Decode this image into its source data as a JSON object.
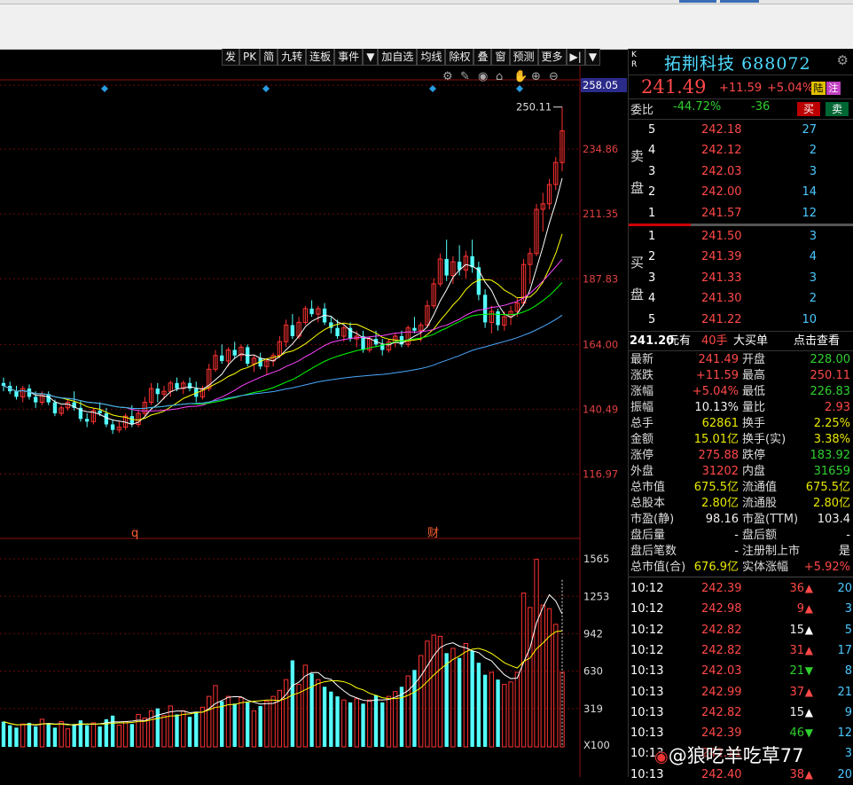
{
  "toolbar": {
    "items": [
      "发",
      "PK",
      "简",
      "九转",
      "连板",
      "事件",
      "▼",
      "加自选",
      "均线",
      "除权",
      "叠",
      "窗",
      "预测",
      "更多",
      "▶|",
      "▼"
    ]
  },
  "price_axis": [
    "258.05",
    "234.86",
    "211.35",
    "187.83",
    "164.00",
    "140.49",
    "116.97"
  ],
  "volume_axis": [
    "1565",
    "1253",
    "942",
    "630",
    "319",
    "X100"
  ],
  "chart_marks": {
    "high_label": "250.11",
    "event_q": "q",
    "event_cai": "财"
  },
  "chart_tools": [
    "settings-icon",
    "pen-icon",
    "eye-icon",
    "lock-icon",
    "hand-icon",
    "zoom-in-icon",
    "zoom-out-icon"
  ],
  "stock": {
    "kr": "K\nR",
    "name": "拓荆科技",
    "code": "688072",
    "price": "241.49",
    "change": "+11.59",
    "pct": "+5.04%",
    "badge": "陆",
    "badge2": "注",
    "weibi_label": "委比",
    "weibi": "-44.72%",
    "weicha": "-36",
    "buy_btn": "买",
    "sell_btn": "卖"
  },
  "asks_label": [
    "卖",
    "盘"
  ],
  "bids_label": [
    "买",
    "盘"
  ],
  "asks": [
    {
      "lv": "5",
      "price": "242.18",
      "vol": "27"
    },
    {
      "lv": "4",
      "price": "242.12",
      "vol": "2"
    },
    {
      "lv": "3",
      "price": "242.03",
      "vol": "3"
    },
    {
      "lv": "2",
      "price": "242.00",
      "vol": "14"
    },
    {
      "lv": "1",
      "price": "241.57",
      "vol": "12"
    }
  ],
  "bids": [
    {
      "lv": "1",
      "price": "241.50",
      "vol": "3"
    },
    {
      "lv": "2",
      "price": "241.39",
      "vol": "4"
    },
    {
      "lv": "3",
      "price": "241.33",
      "vol": "3"
    },
    {
      "lv": "4",
      "price": "241.30",
      "vol": "2"
    },
    {
      "lv": "5",
      "price": "241.22",
      "vol": "10"
    }
  ],
  "bigorder": {
    "price": "241.20",
    "suffix": "元有",
    "lots": "40手",
    "label": "大买单",
    "link": "点击查看"
  },
  "stats": [
    {
      "l1": "最新",
      "v1": "241.49",
      "c1": "red",
      "l2": "开盘",
      "v2": "228.00",
      "c2": "grn"
    },
    {
      "l1": "涨跌",
      "v1": "+11.59",
      "c1": "red",
      "l2": "最高",
      "v2": "250.11",
      "c2": "red"
    },
    {
      "l1": "涨幅",
      "v1": "+5.04%",
      "c1": "red",
      "l2": "最低",
      "v2": "226.83",
      "c2": "grn"
    },
    {
      "l1": "振幅",
      "v1": "10.13%",
      "c1": "wht",
      "l2": "量比",
      "v2": "2.93",
      "c2": "red"
    },
    {
      "l1": "总手",
      "v1": "62861",
      "c1": "yel",
      "l2": "换手",
      "v2": "2.25%",
      "c2": "yel"
    },
    {
      "l1": "金额",
      "v1": "15.01亿",
      "c1": "yel",
      "l2": "换手(实)",
      "v2": "3.38%",
      "c2": "yel"
    },
    {
      "l1": "涨停",
      "v1": "275.88",
      "c1": "red",
      "l2": "跌停",
      "v2": "183.92",
      "c2": "grn"
    },
    {
      "l1": "外盘",
      "v1": "31202",
      "c1": "red",
      "l2": "内盘",
      "v2": "31659",
      "c2": "grn"
    },
    {
      "l1": "总市值",
      "v1": "675.5亿",
      "c1": "yel",
      "l2": "流通值",
      "v2": "675.5亿",
      "c2": "yel"
    },
    {
      "l1": "总股本",
      "v1": "2.80亿",
      "c1": "yel",
      "l2": "流通股",
      "v2": "2.80亿",
      "c2": "yel"
    },
    {
      "l1": "市盈(静)",
      "v1": "98.16",
      "c1": "wht",
      "l2": "市盈(TTM)",
      "v2": "103.4",
      "c2": "wht"
    },
    {
      "l1": "盘后量",
      "v1": "-",
      "c1": "wht",
      "l2": "盘后额",
      "v2": "-",
      "c2": "wht"
    },
    {
      "l1": "盘后笔数",
      "v1": "-",
      "c1": "wht",
      "l2": "注册制上市",
      "v2": "是",
      "c2": "wht"
    },
    {
      "l1": "总市值(合)",
      "v1": "676.9亿",
      "c1": "yel",
      "l2": "实体涨幅",
      "v2": "+5.92%",
      "c2": "red"
    }
  ],
  "ticks": [
    {
      "t": "10:12",
      "p": "242.39",
      "v": "36",
      "dir": "up",
      "c": "red",
      "n": "20"
    },
    {
      "t": "10:12",
      "p": "242.98",
      "v": "9",
      "dir": "up",
      "c": "red",
      "n": "3"
    },
    {
      "t": "10:12",
      "p": "242.82",
      "v": "15",
      "dir": "up",
      "c": "wht",
      "n": "5"
    },
    {
      "t": "10:12",
      "p": "242.82",
      "v": "31",
      "dir": "up",
      "c": "red",
      "n": "17"
    },
    {
      "t": "10:13",
      "p": "242.03",
      "v": "21",
      "dir": "down",
      "c": "grn",
      "n": "8"
    },
    {
      "t": "10:13",
      "p": "242.99",
      "v": "37",
      "dir": "up",
      "c": "red",
      "n": "21"
    },
    {
      "t": "10:13",
      "p": "242.82",
      "v": "15",
      "dir": "up",
      "c": "wht",
      "n": "9"
    },
    {
      "t": "10:13",
      "p": "242.39",
      "v": "46",
      "dir": "down",
      "c": "grn",
      "n": "12"
    },
    {
      "t": "10:13",
      "p": "242.11",
      "v": "",
      "dir": "",
      "c": "wht",
      "n": "3"
    },
    {
      "t": "10:13",
      "p": "242.40",
      "v": "38",
      "dir": "up",
      "c": "red",
      "n": "20"
    }
  ],
  "watermark": "@狼吃羊吃草77",
  "colors": {
    "up": "#ff3232",
    "down": "#54ffff",
    "ma5": "#ffffff",
    "ma10": "#ffff00",
    "ma20": "#ff44ff",
    "ma30": "#00ff00",
    "ma60": "#4aa8ff"
  },
  "chart_data": {
    "type": "candlestick",
    "ylim": [
      116.97,
      258.05
    ],
    "ylim_volume_x100": [
      0,
      1565
    ],
    "ohlc": [
      [
        150.0,
        152.0,
        147.0,
        149.0
      ],
      [
        149.0,
        150.5,
        146.0,
        147.0
      ],
      [
        147.0,
        149.0,
        144.0,
        145.0
      ],
      [
        145.0,
        149.0,
        143.0,
        148.0
      ],
      [
        148.0,
        149.5,
        144.0,
        145.0
      ],
      [
        145.0,
        147.0,
        141.0,
        143.0
      ],
      [
        143.0,
        147.0,
        142.0,
        146.0
      ],
      [
        146.0,
        147.0,
        142.0,
        143.0
      ],
      [
        143.0,
        144.0,
        138.0,
        139.0
      ],
      [
        139.0,
        142.0,
        138.0,
        141.0
      ],
      [
        141.0,
        144.0,
        140.0,
        143.0
      ],
      [
        143.0,
        147.0,
        140.0,
        141.0
      ],
      [
        141.0,
        143.5,
        136.0,
        137.0
      ],
      [
        137.0,
        139.0,
        134.0,
        136.0
      ],
      [
        136.0,
        141.0,
        135.0,
        140.0
      ],
      [
        140.0,
        143.0,
        138.0,
        139.0
      ],
      [
        139.0,
        141.0,
        134.0,
        135.0
      ],
      [
        135.0,
        136.5,
        131.5,
        133.0
      ],
      [
        133.0,
        136.0,
        132.0,
        134.0
      ],
      [
        134.0,
        139.0,
        133.0,
        138.0
      ],
      [
        138.0,
        142.0,
        134.0,
        135.0
      ],
      [
        135.0,
        140.0,
        134.0,
        139.0
      ],
      [
        139.0,
        145.0,
        138.0,
        143.0
      ],
      [
        143.0,
        150.0,
        142.0,
        148.0
      ],
      [
        148.0,
        150.0,
        143.0,
        146.0
      ],
      [
        146.0,
        149.0,
        144.0,
        147.0
      ],
      [
        147.0,
        151.0,
        145.0,
        150.0
      ],
      [
        150.0,
        152.0,
        147.0,
        148.0
      ],
      [
        148.0,
        151.0,
        146.0,
        150.0
      ],
      [
        150.0,
        152.0,
        147.0,
        148.0
      ],
      [
        148.0,
        150.5,
        143.0,
        145.0
      ],
      [
        145.0,
        149.0,
        144.0,
        148.0
      ],
      [
        148.0,
        157.0,
        147.0,
        155.0
      ],
      [
        155.0,
        162.0,
        154.0,
        160.0
      ],
      [
        160.0,
        164.0,
        157.0,
        158.0
      ],
      [
        158.0,
        163.0,
        156.0,
        162.0
      ],
      [
        162.0,
        165.0,
        159.0,
        160.0
      ],
      [
        160.0,
        164.0,
        158.0,
        163.0
      ],
      [
        163.0,
        164.0,
        156.0,
        157.0
      ],
      [
        157.0,
        160.0,
        154.0,
        159.0
      ],
      [
        159.0,
        161.0,
        155.0,
        156.0
      ],
      [
        156.0,
        159.0,
        153.0,
        158.0
      ],
      [
        158.0,
        161.0,
        156.0,
        160.0
      ],
      [
        160.0,
        167.0,
        159.0,
        165.0
      ],
      [
        165.0,
        173.0,
        163.0,
        171.0
      ],
      [
        171.0,
        175.0,
        166.0,
        167.0
      ],
      [
        167.0,
        174.0,
        166.0,
        172.0
      ],
      [
        172.0,
        178.0,
        171.0,
        177.0
      ],
      [
        177.0,
        180.0,
        174.0,
        175.0
      ],
      [
        175.0,
        178.0,
        172.0,
        177.0
      ],
      [
        177.0,
        179.0,
        171.0,
        172.0
      ],
      [
        172.0,
        174.0,
        168.0,
        170.0
      ],
      [
        170.0,
        173.0,
        166.0,
        167.0
      ],
      [
        167.0,
        171.0,
        165.0,
        170.0
      ],
      [
        170.0,
        172.0,
        165.0,
        166.0
      ],
      [
        166.0,
        169.0,
        163.0,
        167.0
      ],
      [
        167.0,
        169.0,
        161.0,
        162.0
      ],
      [
        162.0,
        167.0,
        161.0,
        166.0
      ],
      [
        166.0,
        169.0,
        163.0,
        164.0
      ],
      [
        164.0,
        166.0,
        160.0,
        162.0
      ],
      [
        162.0,
        166.0,
        161.0,
        165.0
      ],
      [
        165.0,
        168.0,
        163.0,
        167.0
      ],
      [
        167.0,
        169.0,
        163.0,
        164.0
      ],
      [
        164.0,
        171.0,
        163.0,
        170.0
      ],
      [
        170.0,
        174.0,
        168.0,
        169.0
      ],
      [
        169.0,
        172.0,
        165.0,
        171.0
      ],
      [
        171.0,
        180.0,
        170.0,
        178.0
      ],
      [
        178.0,
        188.0,
        177.0,
        186.0
      ],
      [
        186.0,
        197.0,
        185.0,
        195.0
      ],
      [
        195.0,
        202.0,
        187.0,
        189.0
      ],
      [
        189.0,
        196.0,
        186.0,
        194.0
      ],
      [
        194.0,
        200.0,
        189.0,
        191.0
      ],
      [
        191.0,
        198.0,
        188.0,
        196.0
      ],
      [
        196.0,
        202.0,
        190.0,
        192.0
      ],
      [
        192.0,
        194.0,
        180.0,
        182.0
      ],
      [
        182.0,
        184.0,
        170.0,
        172.0
      ],
      [
        172.0,
        178.0,
        168.0,
        176.0
      ],
      [
        176.0,
        177.0,
        169.0,
        171.0
      ],
      [
        171.0,
        176.0,
        169.0,
        174.0
      ],
      [
        174.0,
        178.0,
        171.0,
        176.0
      ],
      [
        176.0,
        181.0,
        174.0,
        179.0
      ],
      [
        179.0,
        195.0,
        178.0,
        193.0
      ],
      [
        193.0,
        199.0,
        186.0,
        197.0
      ],
      [
        197.0,
        215.0,
        196.0,
        213.0
      ],
      [
        213.0,
        219.0,
        205.0,
        215.0
      ],
      [
        215.0,
        224.0,
        213.0,
        222.0
      ],
      [
        222.0,
        232.0,
        220.0,
        230.0
      ],
      [
        230.0,
        250.11,
        226.83,
        241.49
      ]
    ],
    "volume_x100": [
      210,
      180,
      160,
      190,
      200,
      170,
      230,
      190,
      160,
      210,
      150,
      190,
      220,
      180,
      200,
      170,
      230,
      260,
      180,
      210,
      190,
      270,
      240,
      300,
      320,
      260,
      340,
      270,
      300,
      250,
      290,
      330,
      420,
      510,
      380,
      420,
      360,
      410,
      370,
      300,
      340,
      380,
      420,
      470,
      560,
      720,
      520,
      680,
      610,
      560,
      500,
      460,
      420,
      390,
      370,
      400,
      360,
      390,
      430,
      370,
      420,
      460,
      500,
      590,
      640,
      760,
      880,
      930,
      920,
      780,
      820,
      740,
      860,
      800,
      700,
      600,
      620,
      560,
      520,
      540,
      620,
      1280,
      1160,
      1560,
      1180,
      1150,
      1020,
      620
    ]
  }
}
